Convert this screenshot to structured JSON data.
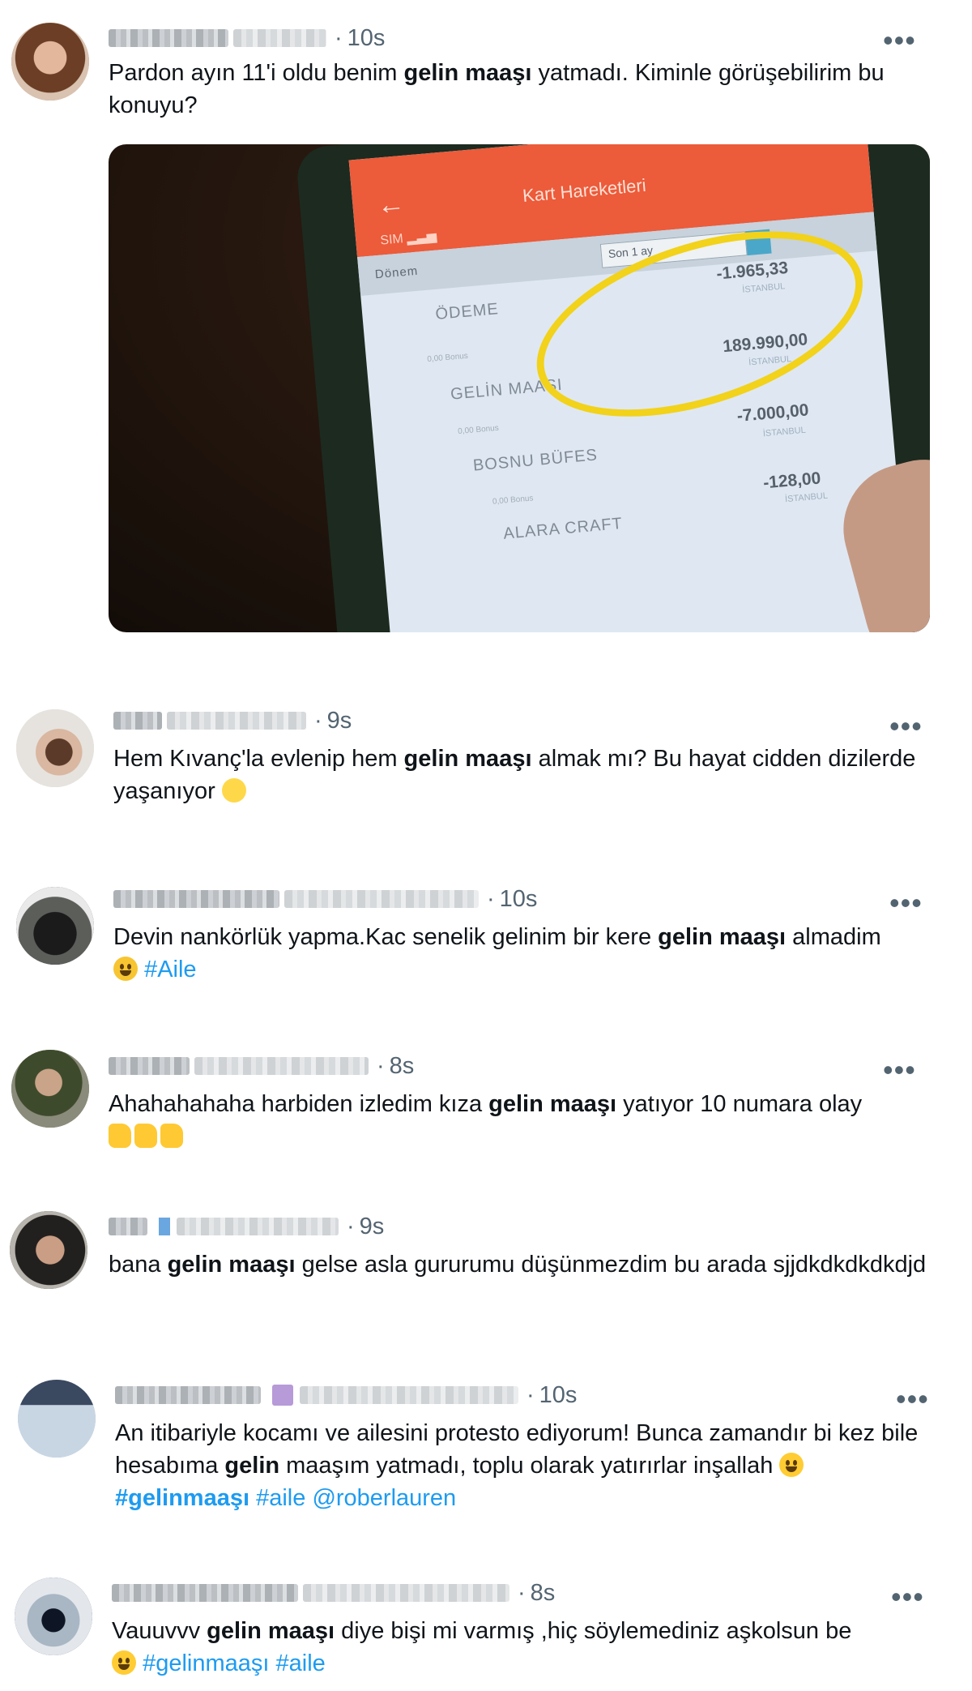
{
  "tweets": [
    {
      "time": "10s",
      "text_before": "Pardon ayın 11'i oldu benim ",
      "bold": "gelin maaşı",
      "text_after": " yatmadı. Kiminle görüşebilirim bu konuyu?"
    },
    {
      "time": "9s",
      "text_before": "Hem Kıvanç'la evlenip hem ",
      "bold": "gelin maaşı",
      "text_after": " almak mı? Bu hayat cidden dizilerde yaşanıyor"
    },
    {
      "time": "10s",
      "text_before": "Devin nankörlük yapma.Kac senelik gelinim bir kere ",
      "bold": "gelin maaşı",
      "text_after": " almadim",
      "hashtag": "#Aile"
    },
    {
      "time": "8s",
      "text_before": "Ahahahahaha harbiden izledim kıza ",
      "bold": "gelin maaşı",
      "text_after": " yatıyor 10 numara olay"
    },
    {
      "time": "9s",
      "text_before": "bana ",
      "bold": "gelin maaşı",
      "text_after": " gelse asla gururumu düşünmezdim bu arada sjjdkdkdkdkdjd"
    },
    {
      "time": "10s",
      "text_before": "An itibariyle kocamı ve ailesini protesto ediyorum! Bunca zamandır bi kez bile hesabıma ",
      "bold": "gelin",
      "text_after": " maaşım yatmadı, toplu olarak yatırırlar inşallah",
      "hashtag_bold": "#gelinmaaşı",
      "hashtag2": "#aile",
      "mention": "@roberlauren"
    },
    {
      "time": "8s",
      "text_before": "Vauuvvv ",
      "bold": "gelin maaşı",
      "text_after": " diye bişi mi varmış  ,hiç söylemediniz aşkolsun be",
      "hashtag": "#gelinmaaşı",
      "hashtag2": "#aile"
    }
  ],
  "photo": {
    "header_title": "Kart Hareketleri",
    "filter_label": "Dönem",
    "filter_value": "Son 1 ay",
    "rows": [
      {
        "merchant": "ÖDEME",
        "bonus": "",
        "amount": "-1.965,33",
        "city": "İSTANBUL"
      },
      {
        "merchant": "GELİN MAAŞI",
        "bonus": "0,00 Bonus",
        "amount": "189.990,00",
        "city": "İSTANBUL"
      },
      {
        "merchant": "BOSNU BÜFES",
        "bonus": "0,00 Bonus",
        "amount": "-7.000,00",
        "city": "İSTANBUL"
      },
      {
        "merchant": "ALARA CRAFT",
        "bonus": "0,00 Bonus",
        "amount": "-128,00",
        "city": "İSTANBUL"
      }
    ]
  },
  "more_label": "•••",
  "dot": "·"
}
